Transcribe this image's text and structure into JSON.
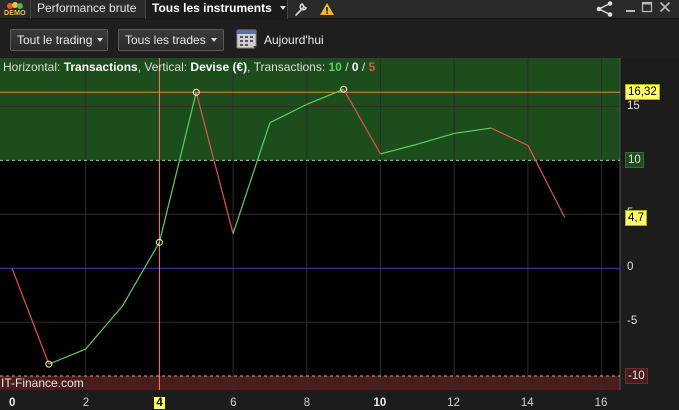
{
  "titlebar": {
    "logo_badge": "DEMO",
    "tab_performance": "Performance brute",
    "tab_instruments": "Tous les instruments",
    "icons": [
      "wrench-icon",
      "warning-icon",
      "share-icon",
      "minimize-icon",
      "maximize-icon",
      "close-icon"
    ]
  },
  "toolbar": {
    "filter_trading": "Tout le trading",
    "filter_trades": "Tous les trades",
    "date_label": "Aujourd'hui"
  },
  "info": {
    "horizontal_prefix": "Horizontal: ",
    "horizontal_value": "Transactions",
    "vertical_prefix": ", Vertical: ",
    "vertical_value": "Devise (€)",
    "transactions_prefix": ", Transactions: ",
    "count_green": "10",
    "sep1": " / ",
    "count_zero": "0",
    "sep2": " / ",
    "count_red": "5"
  },
  "watermark": "IT-Finance.com",
  "badges": {
    "max_value": "16,32",
    "upper_band": "10",
    "last_value": "4,7",
    "lower_band": "-10"
  },
  "colors": {
    "up": "#5ad35a",
    "down": "#e0554a",
    "zero_line": "#3a3ad8",
    "crosshair": "#ff8060",
    "upper_zone": "#1d4c1d",
    "lower_zone": "#4a1c1c",
    "badge_yellow": "#ffff66"
  },
  "chart_data": {
    "type": "line",
    "xlabel": "",
    "ylabel": "",
    "x": [
      0,
      1,
      2,
      3,
      4,
      5,
      6,
      7,
      8,
      9,
      10,
      11,
      12,
      13,
      14,
      15
    ],
    "values": [
      0,
      -8.9,
      -7.5,
      -3.5,
      2.4,
      16.32,
      3.2,
      13.5,
      15.2,
      16.6,
      10.6,
      11.5,
      12.5,
      13.0,
      11.4,
      4.7
    ],
    "segment_direction": [
      "down",
      "up",
      "up",
      "up",
      "up",
      "down",
      "up",
      "up",
      "up",
      "down",
      "up",
      "up",
      "up",
      "down",
      "down"
    ],
    "marked_points": [
      1,
      4,
      5,
      9
    ],
    "xlim": [
      0,
      16.5
    ],
    "ylim": [
      -11.3,
      19.5
    ],
    "x_ticks": [
      "0",
      "2",
      "4",
      "6",
      "8",
      "10",
      "12",
      "14",
      "16"
    ],
    "x_ticks_bold": [
      "0",
      "10"
    ],
    "y_ticks": [
      "15",
      "10",
      "5",
      "0",
      "-5",
      "-10"
    ],
    "crosshair_x": 4,
    "crosshair_x_label": "4",
    "max_line": 16.32,
    "upper_band": 10,
    "lower_band": -10,
    "grid": true
  }
}
